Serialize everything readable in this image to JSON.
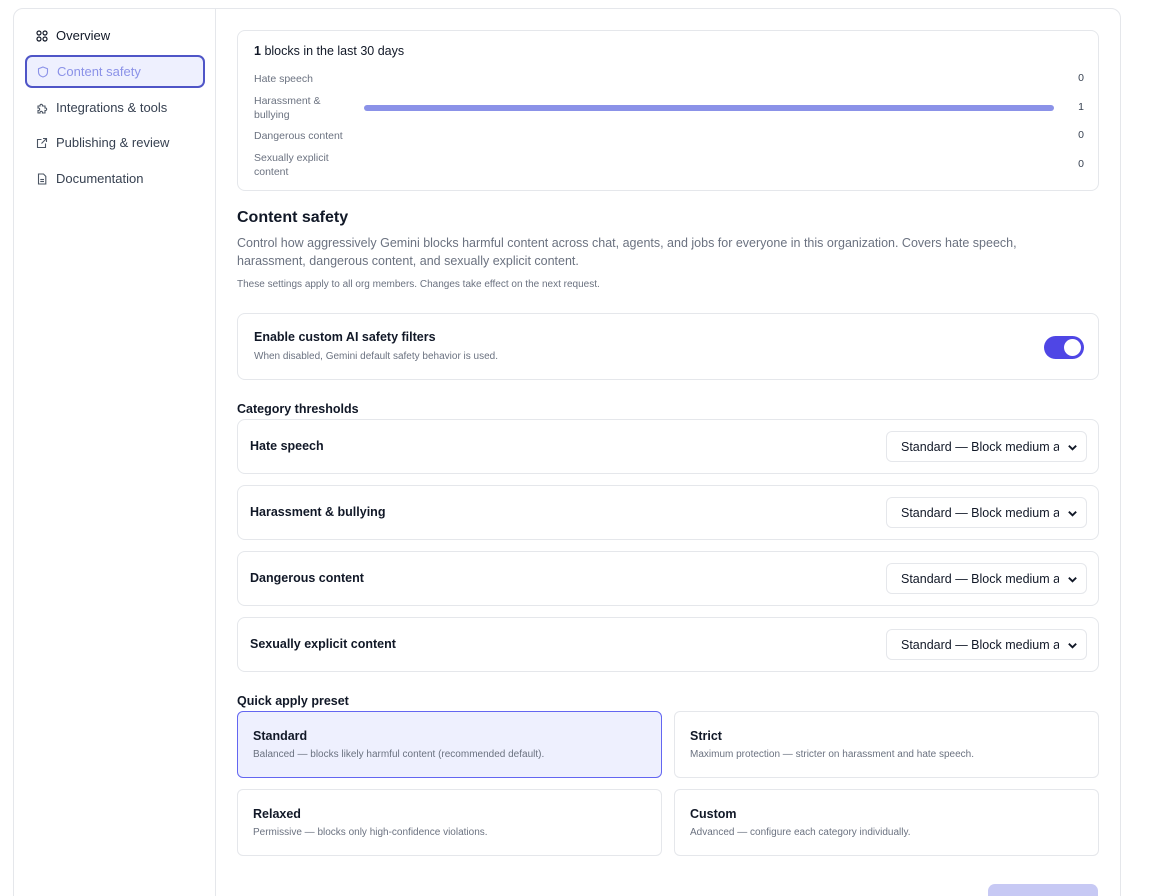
{
  "sidebar": {
    "items": [
      {
        "label": "Overview",
        "icon": "grid-icon"
      },
      {
        "label": "Content safety",
        "icon": "shield-icon"
      },
      {
        "label": "Integrations & tools",
        "icon": "puzzle-icon"
      },
      {
        "label": "Publishing & review",
        "icon": "external-link-icon"
      },
      {
        "label": "Documentation",
        "icon": "document-icon"
      }
    ]
  },
  "stats": {
    "count": "1",
    "title_suffix": "blocks in the last 30 days",
    "rows": [
      {
        "label": "Hate speech",
        "count": "0",
        "fraction": 0
      },
      {
        "label": "Harassment & bullying",
        "count": "1",
        "fraction": 1
      },
      {
        "label": "Dangerous content",
        "count": "0",
        "fraction": 0
      },
      {
        "label": "Sexually explicit content",
        "count": "0",
        "fraction": 0
      }
    ]
  },
  "content_safety": {
    "title": "Content safety",
    "description": "Control how aggressively Gemini blocks harmful content across chat, agents, and jobs for everyone in this organization. Covers hate speech, harassment, dangerous content, and sexually explicit content.",
    "note": "These settings apply to all org members. Changes take effect on the next request."
  },
  "toggle": {
    "title": "Enable custom AI safety filters",
    "subtitle": "When disabled, Gemini default safety behavior is used.",
    "enabled": true
  },
  "thresholds": {
    "heading": "Category thresholds",
    "items": [
      {
        "label": "Hate speech",
        "value": "Standard — Block medium and above"
      },
      {
        "label": "Harassment & bullying",
        "value": "Standard — Block medium and above"
      },
      {
        "label": "Dangerous content",
        "value": "Standard — Block medium and above"
      },
      {
        "label": "Sexually explicit content",
        "value": "Standard — Block medium and above"
      }
    ]
  },
  "presets": {
    "heading": "Quick apply preset",
    "items": [
      {
        "name": "Standard",
        "desc": "Balanced — blocks likely harmful content (recommended default).",
        "selected": true
      },
      {
        "name": "Strict",
        "desc": "Maximum protection — stricter on harassment and hate speech.",
        "selected": false
      },
      {
        "name": "Relaxed",
        "desc": "Permissive — blocks only high-confidence violations.",
        "selected": false
      },
      {
        "name": "Custom",
        "desc": "Advanced — configure each category individually.",
        "selected": false
      }
    ]
  },
  "colors": {
    "accent": "#4f46e5",
    "accent_light": "#8b92e8",
    "selected_bg": "#eef0fe",
    "border": "#e5e7eb"
  }
}
